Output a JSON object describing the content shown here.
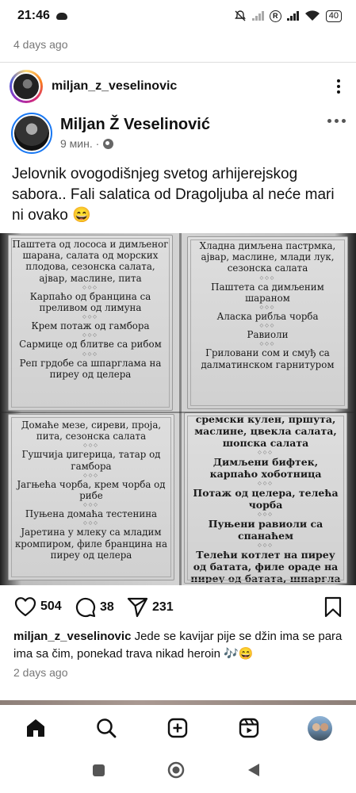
{
  "status_bar": {
    "time": "21:46",
    "battery": "40",
    "icons": [
      "cloud-icon",
      "mute-icon",
      "signal-icon",
      "r-icon",
      "signal-icon",
      "wifi-icon",
      "battery-icon"
    ]
  },
  "previous_post": {
    "timestamp": "4 days ago"
  },
  "post": {
    "username": "miljan_z_veselinovic",
    "shared": {
      "author": "Miljan Ž Veselinović",
      "time": "9 мин. ·",
      "text": "Jelovnik ovogodišnjeg svetog arhijerejskog sabora.. Fali salatica od Dragoljuba al neće mari ni ovako 😄"
    },
    "menu": {
      "separator": "◇◇◇",
      "top_left": [
        "Паштета од лососа и димљеног шарана, салата од морских плодова, сезонска салата, ајвар, маслине, пита",
        "Карпаћо од бранцина са преливом од лимуна",
        "Крем потаж од гамбора",
        "Сармице од блитве са рибом",
        "Реп грдобе са шпарглама на пиреу од целера"
      ],
      "top_right": [
        "Хладна димљена пастрмка, ајвар, маслине, млади лук, сезонска салата",
        "Паштета са димљеним шараном",
        "Аласка рибља чорба",
        "Равиоли",
        "Гриловани сом и смуђ са далматинском гарнитуром"
      ],
      "bottom_left": [
        "Домаће мезе, сиреви, проја, пита, сезонска салата",
        "Гушчија џигерица, татар од гамбора",
        "Јагњећа чорба, крем чорба од рибе",
        "Пуњена домаћа тестенина",
        "Јаретина у млеку са младим кромпиром, филе бранцина на пиреу од целера"
      ],
      "bottom_right": [
        "сремски кулен, пршута, маслине, цвекла салата, шопска салата",
        "Димљени бифтек, карпаћо хоботница",
        "Потаж од целера, телећа чорба",
        "Пуњени равиоли са спанаћем",
        "Телећи котлет на пиреу од батата, филе ораде на пиреу од батата, шпаргла"
      ]
    },
    "actions": {
      "likes": "504",
      "comments": "38",
      "shares": "231"
    },
    "caption": {
      "username": "miljan_z_veselinovic",
      "text": "Jede se kavijar pije se džin ima se para ima sa čim, ponekad trava nikad heroin 🎶😄"
    },
    "timestamp": "2 days ago"
  },
  "bottom_nav": {
    "items": [
      "home-icon",
      "search-icon",
      "create-icon",
      "reels-icon",
      "profile-avatar"
    ]
  },
  "system_nav": {
    "items": [
      "recents-button",
      "home-button",
      "back-button"
    ]
  }
}
